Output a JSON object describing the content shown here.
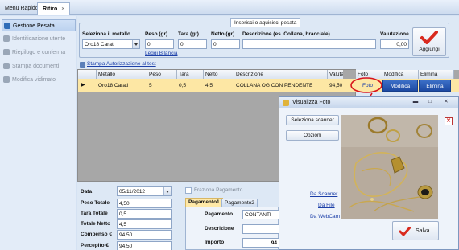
{
  "tabs": [
    {
      "label": "Menu Rapido"
    },
    {
      "label": "Ritiro",
      "close": "×"
    }
  ],
  "sidebar": {
    "items": [
      {
        "label": "Gestione Pesata",
        "state": "active",
        "color": "#2f6db8"
      },
      {
        "label": "Identificazione utente",
        "state": "disabled",
        "color": "#9aa7b8"
      },
      {
        "label": "Riepilogo e conferma",
        "state": "disabled",
        "color": "#9aa7b8"
      },
      {
        "label": "Stampa documenti",
        "state": "disabled",
        "color": "#9aa7b8"
      },
      {
        "label": "Modifica vidimato",
        "state": "disabled",
        "color": "#9aa7b8"
      }
    ]
  },
  "entry": {
    "group_title": "Inserisci o aquisisci pesata",
    "metal_label": "Seleziona il metallo",
    "metal_value": "Oro18 Carati",
    "peso_label": "Peso (gr)",
    "peso_value": "0",
    "tara_label": "Tara (gr)",
    "tara_value": "0",
    "netto_label": "Netto (gr)",
    "netto_value": "0",
    "descr_label": "Descrizione (es. Collana, bracciale)",
    "descr_value": "",
    "valutazione_label": "Valutazione",
    "valutazione_value": "0,00",
    "leggi_bilancia": "Leggi Bilancia",
    "aggiungi": "Aggiungi"
  },
  "print_auth_link": "Stampa Autorizzazione al test",
  "grid": {
    "headers": [
      "Metallo",
      "Peso",
      "Tara",
      "Netto",
      "Descrizione",
      "Valutazione",
      "Foto",
      "Modifica",
      "Elimina"
    ],
    "row": {
      "marker": "▶",
      "metallo": "Oro18 Carati",
      "peso": "5",
      "tara": "0,5",
      "netto": "4,5",
      "descrizione": "COLLANA OG CON PENDENTE",
      "valutazione": "94,50",
      "foto": "Foto",
      "modifica": "Modifica",
      "elimina": "Elimina"
    }
  },
  "summary": {
    "data_label": "Data",
    "data_value": "05/11/2012",
    "peso_totale_label": "Peso Totale",
    "peso_totale_value": "4,50",
    "tara_totale_label": "Tara Totale",
    "tara_totale_value": "0,5",
    "totale_netto_label": "Totale Netto",
    "totale_netto_value": "4,5",
    "compenso_label": "Compenso €",
    "compenso_value": "94,50",
    "percepito_label": "Percepito €",
    "percepito_value": "94,50"
  },
  "payment": {
    "frazionato_label": "Fraziona Pagamento",
    "tab1": "Pagamento1",
    "tab2": "Pagamento2",
    "pagamento_label": "Pagamento",
    "pagamento_value": "CONTANTI",
    "descrizione_label": "Descrizione",
    "descrizione_value": "",
    "importo_label": "Importo",
    "importo_value": "94"
  },
  "photo_window": {
    "title": "Visualizza Foto",
    "seleziona_scanner": "Seleziona scanner",
    "opzioni": "Opzioni",
    "da_scanner": "Da Scanner",
    "da_file": "Da File",
    "da_webcam": "Da WebCam",
    "salva": "Salva"
  },
  "colors": {
    "selected_row": "#fde7a4",
    "annotation_red": "#d8141b",
    "check_red": "#d92a1e",
    "grid_bg": "#a7a7a7"
  }
}
